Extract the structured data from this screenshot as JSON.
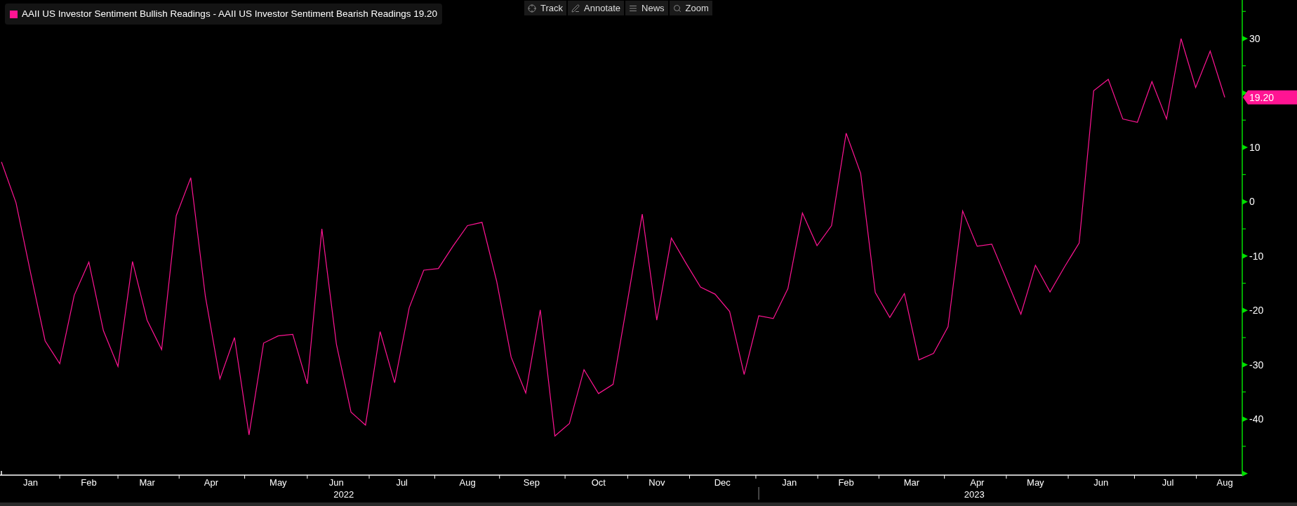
{
  "toolbar": [
    {
      "label": "Track",
      "kind": "track"
    },
    {
      "label": "Annotate",
      "kind": "annotate"
    },
    {
      "label": "News",
      "kind": "news"
    },
    {
      "label": "Zoom",
      "kind": "zoom"
    }
  ],
  "legend": {
    "value": "19.20"
  },
  "chart": {
    "last_value_tag": "19.20",
    "year_labels": [
      "2022",
      "2023"
    ],
    "month_labels": [
      "Jan",
      "Feb",
      "Mar",
      "Apr",
      "May",
      "Jun",
      "Jul",
      "Aug",
      "Sep",
      "Oct",
      "Nov",
      "Dec",
      "Jan",
      "Feb",
      "Mar",
      "Apr",
      "May",
      "Jun",
      "Jul",
      "Aug"
    ],
    "chart_data": {
      "type": "line",
      "ylim": [
        -50.3,
        37.1
      ],
      "yticks": [
        30,
        10,
        0,
        -10,
        -20,
        -30,
        -40
      ],
      "series": [
        {
          "name": "AAII US Investor Sentiment Bullish Readings - AAII US Investor Sentiment Bearish Readings",
          "color": "#ff1493",
          "values": [
            7.3,
            -0.2,
            -13.1,
            -25.6,
            -29.8,
            -17.2,
            -11.1,
            -23.7,
            -30.3,
            -11.0,
            -21.8,
            -27.2,
            -2.6,
            4.4,
            -17.4,
            -32.6,
            -25.0,
            -42.9,
            -26.0,
            -24.7,
            -24.4,
            -33.5,
            -5.0,
            -26.2,
            -38.7,
            -41.1,
            -23.9,
            -33.3,
            -19.5,
            -12.6,
            -12.3,
            -8.2,
            -4.4,
            -3.8,
            -14.6,
            -28.6,
            -35.2,
            -19.9,
            -43.1,
            -40.8,
            -30.9,
            -35.3,
            -33.6,
            -18.1,
            -2.3,
            -21.8,
            -6.7,
            -11.3,
            -15.7,
            -17.0,
            -20.2,
            -31.8,
            -21.0,
            -21.5,
            -16.0,
            -2.1,
            -8.1,
            -4.4,
            12.6,
            5.2,
            -16.7,
            -21.3,
            -16.9,
            -29.1,
            -27.9,
            -23.0,
            -1.7,
            -8.2,
            -7.8,
            -14.2,
            -20.7,
            -11.7,
            -16.6,
            -12.0,
            -7.6,
            20.4,
            22.5,
            15.2,
            14.6,
            22.1,
            15.2,
            30.0,
            21.0,
            27.7,
            19.2
          ]
        }
      ]
    }
  }
}
